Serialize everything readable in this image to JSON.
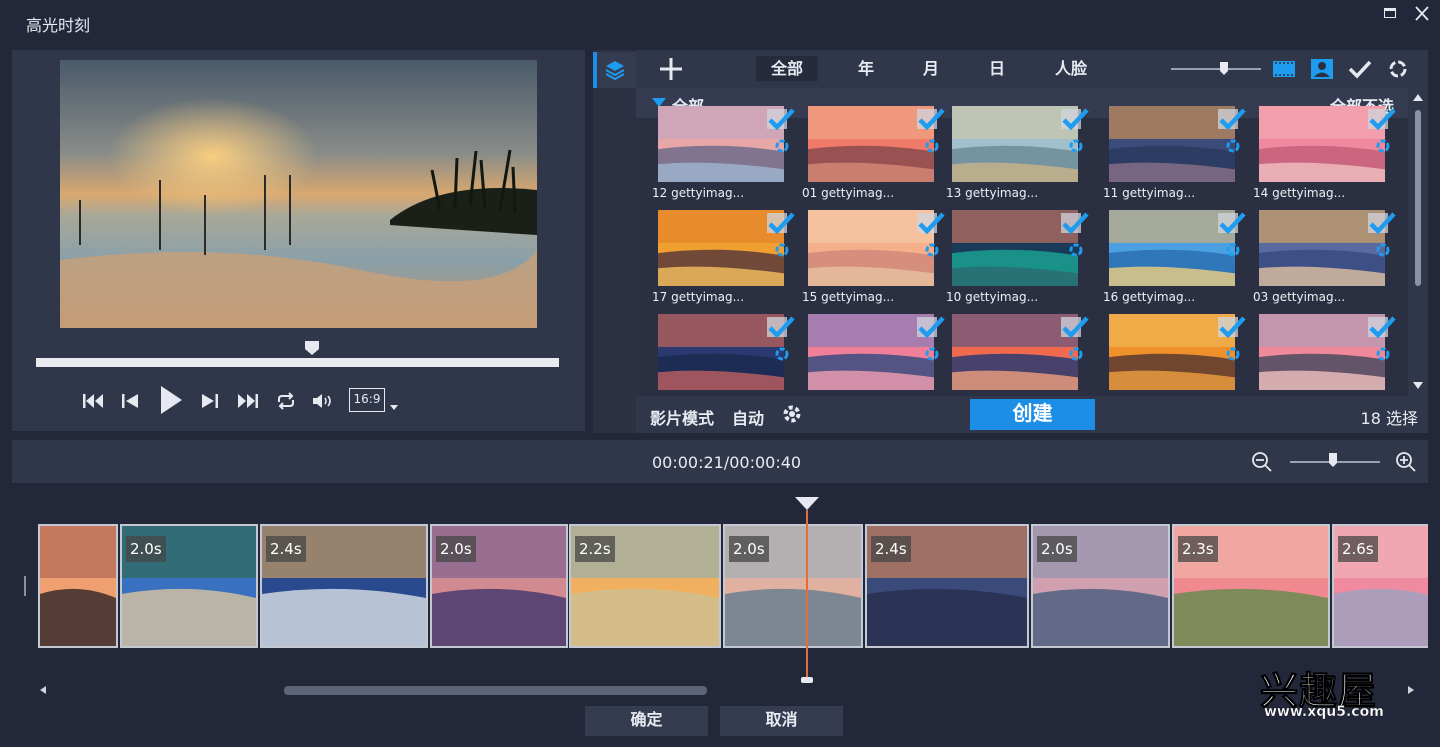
{
  "window": {
    "title": "高光时刻"
  },
  "preview": {
    "ratio": "16:9"
  },
  "library": {
    "tabs": [
      "全部",
      "年",
      "月",
      "日",
      "人脸"
    ],
    "section_label": "全部",
    "deselect_all": "全部不选",
    "thumbnails": [
      {
        "name": "12 gettyimag...",
        "palette": [
          "#e7a7a6",
          "#b9a6c4",
          "#6d6b8a",
          "#9fb6d2"
        ]
      },
      {
        "name": "01 gettyimag...",
        "palette": [
          "#f07a6a",
          "#f0b08c",
          "#8a4a4e",
          "#d48a78"
        ]
      },
      {
        "name": "13 gettyimag...",
        "palette": [
          "#9fc0cc",
          "#d9c9a0",
          "#6f8c96",
          "#c9b48a"
        ]
      },
      {
        "name": "11 gettyimag...",
        "palette": [
          "#3a4d7a",
          "#f0a050",
          "#2b3a5e",
          "#88708a"
        ]
      },
      {
        "name": "14 gettyimag...",
        "palette": [
          "#f088a0",
          "#f6b0b4",
          "#c4607a",
          "#f0c0c0"
        ]
      },
      {
        "name": "17 gettyimag...",
        "palette": [
          "#f0a030",
          "#e07a2a",
          "#5a3a3a",
          "#f6c060"
        ]
      },
      {
        "name": "15 gettyimag...",
        "palette": [
          "#f4b08a",
          "#f6d0b0",
          "#d08a7a",
          "#e8c0a0"
        ]
      },
      {
        "name": "10 gettyimag...",
        "palette": [
          "#1a3a5a",
          "#f08060",
          "#1aa090",
          "#2a6a70"
        ]
      },
      {
        "name": "16 gettyimag...",
        "palette": [
          "#4aa0e0",
          "#f0b060",
          "#2a70b0",
          "#f0d080"
        ]
      },
      {
        "name": "03 gettyimag...",
        "palette": [
          "#5a6aa0",
          "#f0b050",
          "#3a4a80",
          "#e0c0a0"
        ]
      },
      {
        "name": "",
        "palette": [
          "#2a3a70",
          "#f07050",
          "#1a2a50",
          "#c06060"
        ]
      },
      {
        "name": "",
        "palette": [
          "#f0809a",
          "#6a7ac0",
          "#3a4a80",
          "#f0a0b0"
        ]
      },
      {
        "name": "",
        "palette": [
          "#f06a50",
          "#3a5090",
          "#2a3a70",
          "#f0a080"
        ]
      },
      {
        "name": "",
        "palette": [
          "#f0902a",
          "#f0c060",
          "#5a3a30",
          "#f0a040"
        ]
      },
      {
        "name": "",
        "palette": [
          "#f08a9a",
          "#a0a0c0",
          "#4a4a60",
          "#f0c0c0"
        ]
      }
    ],
    "footer": {
      "mode_label": "影片模式",
      "mode_value": "自动",
      "create": "创建",
      "selection": "18 选择"
    }
  },
  "timeline": {
    "timecode": "00:00:21/00:00:40",
    "clips": [
      {
        "dur": "",
        "palette": [
          "#f0a070",
          "#a05a50",
          "#3a2a2a"
        ]
      },
      {
        "dur": "2.0s",
        "palette": [
          "#3a70c0",
          "#2a6a3a",
          "#d0c0a0"
        ]
      },
      {
        "dur": "2.4s",
        "palette": [
          "#2a4a90",
          "#f0b050",
          "#d0d8e0"
        ]
      },
      {
        "dur": "2.0s",
        "palette": [
          "#d08a90",
          "#6a5a90",
          "#4a3a70"
        ]
      },
      {
        "dur": "2.2s",
        "palette": [
          "#f0b060",
          "#80b0c0",
          "#d0c090"
        ]
      },
      {
        "dur": "2.0s",
        "palette": [
          "#e0b0a0",
          "#90b0c0",
          "#6a8090"
        ]
      },
      {
        "dur": "2.4s",
        "palette": [
          "#3a4a7a",
          "#f09050",
          "#2a3050"
        ]
      },
      {
        "dur": "2.0s",
        "palette": [
          "#d0a0b0",
          "#8090b0",
          "#506080"
        ]
      },
      {
        "dur": "2.3s",
        "palette": [
          "#f08a90",
          "#f0c0b0",
          "#6a8a50"
        ]
      },
      {
        "dur": "2.6s",
        "palette": [
          "#f08aa0",
          "#f0c0c0",
          "#a0a0c0"
        ]
      }
    ]
  },
  "buttons": {
    "ok": "确定",
    "cancel": "取消"
  },
  "watermark": {
    "title": "兴趣屋",
    "url": "www.xqu5.com"
  },
  "colors": {
    "accent": "#1c8ee6",
    "panel": "#31374a",
    "background": "#22273a",
    "playhead": "#e0703a"
  }
}
